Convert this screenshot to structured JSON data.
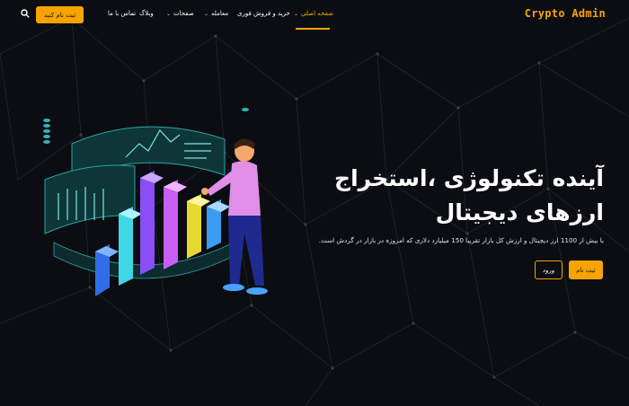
{
  "brand": {
    "name": "Crypto Admin",
    "accent": "#f7a400"
  },
  "navbar": {
    "signup_label": "ثبت نام کنید",
    "search_icon": "search-icon",
    "menu": [
      {
        "label": "صفحه اصلی",
        "active": true,
        "has_dropdown": true
      },
      {
        "label": "خرید و فروش فوری",
        "active": false,
        "has_dropdown": false
      },
      {
        "label": "معامله",
        "active": false,
        "has_dropdown": true
      },
      {
        "label": "صفحات",
        "active": false,
        "has_dropdown": true
      },
      {
        "label": "وبلاگ",
        "active": false,
        "has_dropdown": true
      },
      {
        "label": "تماس با ما",
        "active": false,
        "has_dropdown": false
      }
    ]
  },
  "hero": {
    "title_line1": "آینده تکنولوژی ،استخراج",
    "title_line2": "ارزهای دیجیتال",
    "description": "با بیش از 1100 ارز دیجیتال و ارزش کل بازار تقریبا 150 میلیارد دلاری که امروزه در بازار در گردش است.",
    "register_button": "ثبت نام",
    "login_button": "ورود"
  },
  "colors": {
    "background": "#0b0d12",
    "accent": "#f7a400"
  }
}
